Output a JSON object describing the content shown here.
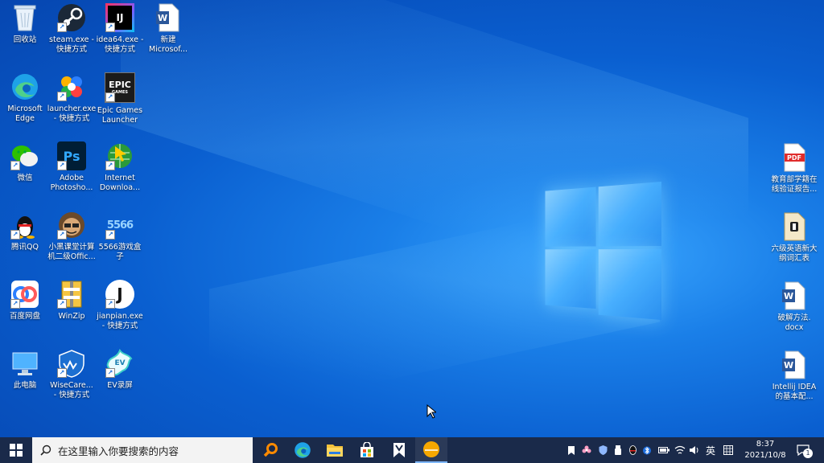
{
  "desktop": {
    "icons": [
      {
        "label": "回收站",
        "icon": "recycle-bin-icon"
      },
      {
        "label": "steam.exe -\n快捷方式",
        "icon": "steam-icon"
      },
      {
        "label": "idea64.exe -\n快捷方式",
        "icon": "intellij-idea-icon"
      },
      {
        "label": "新建\nMicrosof...",
        "icon": "word-document-icon"
      },
      {
        "label": "Microsoft\nEdge",
        "icon": "edge-icon"
      },
      {
        "label": "launcher.exe\n- 快捷方式",
        "icon": "launcher-icon"
      },
      {
        "label": "Epic Games\nLauncher",
        "icon": "epic-games-icon"
      },
      {
        "label": "微信",
        "icon": "wechat-icon"
      },
      {
        "label": "Adobe\nPhotosho...",
        "icon": "photoshop-icon"
      },
      {
        "label": "Internet\nDownloa...",
        "icon": "internet-download-manager-icon"
      },
      {
        "label": "腾讯QQ",
        "icon": "qq-icon"
      },
      {
        "label": "小黑课堂计算\n机二级Offic...",
        "icon": "xiaohei-ketang-icon"
      },
      {
        "label": "5566游戏盒\n子",
        "icon": "5566-game-box-icon"
      },
      {
        "label": "百度网盘",
        "icon": "baidu-netdisk-icon"
      },
      {
        "label": "WinZip",
        "icon": "winzip-icon"
      },
      {
        "label": "jianpian.exe\n- 快捷方式",
        "icon": "jianpian-icon"
      },
      {
        "label": "此电脑",
        "icon": "this-pc-icon"
      },
      {
        "label": "WiseCare...\n- 快捷方式",
        "icon": "wisecare-icon"
      },
      {
        "label": "EV录屏",
        "icon": "ev-recorder-icon"
      },
      {
        "label": "教育部学籍在\n线验证报告...",
        "icon": "pdf-file-icon"
      },
      {
        "label": "六级英语新大\n纲词汇表",
        "icon": "vocab-file-icon"
      },
      {
        "label": "破解方法.\ndocx",
        "icon": "word-document-icon"
      },
      {
        "label": "Intellij IDEA\n的基本配...",
        "icon": "word-document-icon"
      }
    ],
    "glyphs": {
      "idea": "IJ",
      "word": "W",
      "epic": "EPIC",
      "epic_sub": "GAMES",
      "ps": "Ps",
      "game5566": "5566",
      "pdf": "PDF",
      "jianpian": "J",
      "ev": "EV"
    },
    "colors": {
      "accent": "#0a5fd0",
      "taskbar": "#1a2a4a"
    }
  },
  "taskbar": {
    "search_placeholder": "在这里输入你要搜索的内容",
    "pinned": [
      {
        "name": "search-app-icon"
      },
      {
        "name": "edge-icon"
      },
      {
        "name": "file-explorer-icon"
      },
      {
        "name": "microsoft-store-icon"
      },
      {
        "name": "bookmark-app-icon"
      },
      {
        "name": "orange-app-icon"
      }
    ],
    "tray": {
      "ime": "英",
      "time": "8:37",
      "date": "2021/10/8",
      "notifications": "1"
    }
  }
}
